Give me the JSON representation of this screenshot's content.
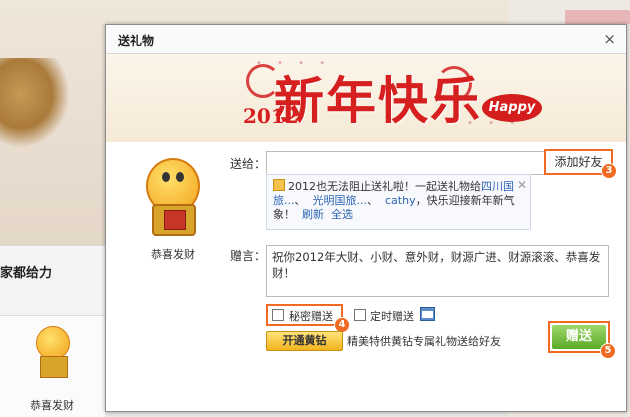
{
  "background": {
    "section_text": "家都给力",
    "mascot_label": "恭喜发财"
  },
  "dialog": {
    "title": "送礼物",
    "close": "×",
    "banner": {
      "title": "新年快乐",
      "year": "2012",
      "happy": "Happy"
    },
    "mascot_label": "恭喜发财",
    "to_label": "送给：",
    "to_value": "",
    "add_friend": "添加好友",
    "tip": {
      "text_before": "2012也无法阻止送礼啦！一起送礼物给",
      "friend1": "四川国旅...",
      "sep": "、",
      "friend2": "光明国旅...",
      "friend3": "cathy",
      "text_after": "，快乐迎接新年新气象！",
      "refresh": "刷新",
      "select_all": "全选",
      "close": "✕"
    },
    "message_label": "赠言：",
    "message": "祝你2012年大财、小财、意外财，财源广进、财源滚滚、恭喜发财！",
    "secret_label": "秘密赠送",
    "timed_label": "定时赠送",
    "vip_button": "开通黄钻",
    "vip_note": "精美特供黄钻专属礼物送给好友",
    "send_button": "赠送",
    "badges": {
      "add": "3",
      "secret": "4",
      "send": "5"
    }
  },
  "colors": {
    "accent": "#f06a22",
    "send": "#6cb832",
    "festive_red": "#d62020"
  }
}
